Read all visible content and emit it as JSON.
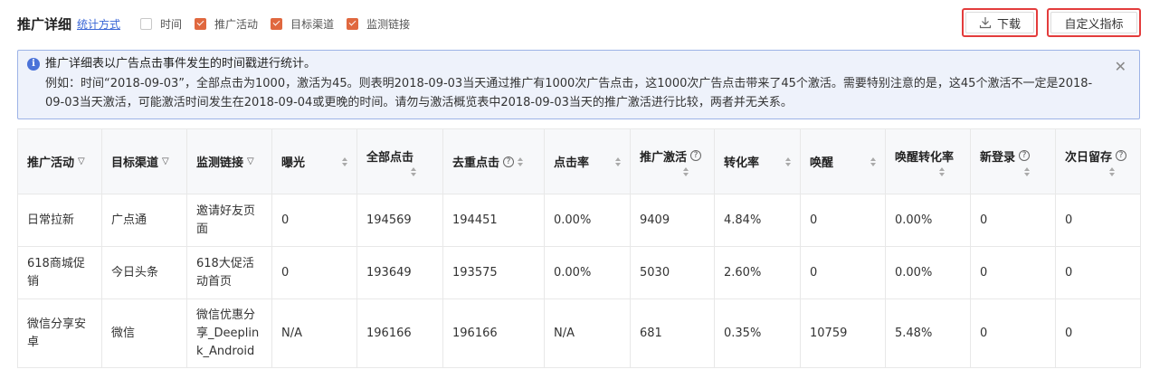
{
  "header": {
    "title": "推广详细",
    "stat_link": "统计方式",
    "checkboxes": [
      {
        "label": "时间",
        "checked": false
      },
      {
        "label": "推广活动",
        "checked": true
      },
      {
        "label": "目标渠道",
        "checked": true
      },
      {
        "label": "监测链接",
        "checked": true
      }
    ],
    "download_label": "下载",
    "custom_label": "自定义指标"
  },
  "notice": {
    "line1": "推广详细表以广告点击事件发生的时间戳进行统计。",
    "line2": "例如：时间“2018-09-03”，全部点击为1000，激活为45。则表明2018-09-03当天通过推广有1000次广告点击，这1000次广告点击带来了45个激活。需要特别注意的是，这45个激活不一定是2018-09-03当天激活，可能激活时间发生在2018-09-04或更晚的时间。请勿与激活概览表中2018-09-03当天的推广激活进行比较，两者并无关系。"
  },
  "table": {
    "columns": [
      "推广活动",
      "目标渠道",
      "监测链接",
      "曝光",
      "全部点击",
      "去重点击",
      "点击率",
      "推广激活",
      "转化率",
      "唤醒",
      "唤醒转化率",
      "新登录",
      "次日留存"
    ],
    "rows": [
      [
        "日常拉新",
        "广点通",
        "邀请好友页面",
        "0",
        "194569",
        "194451",
        "0.00%",
        "9409",
        "4.84%",
        "0",
        "0.00%",
        "0",
        "0"
      ],
      [
        "618商城促销",
        "今日头条",
        "618大促活动首页",
        "0",
        "193649",
        "193575",
        "0.00%",
        "5030",
        "2.60%",
        "0",
        "0.00%",
        "0",
        "0"
      ],
      [
        "微信分享安卓",
        "微信",
        "微信优惠分享_Deeplink_Android",
        "N/A",
        "196166",
        "196166",
        "N/A",
        "681",
        "0.35%",
        "10759",
        "5.48%",
        "0",
        "0"
      ]
    ]
  },
  "colors": {
    "accent": "#e0683f",
    "link": "#3a66d6",
    "highlight": "#e33c3c",
    "notice_bg": "#eef2fb"
  }
}
